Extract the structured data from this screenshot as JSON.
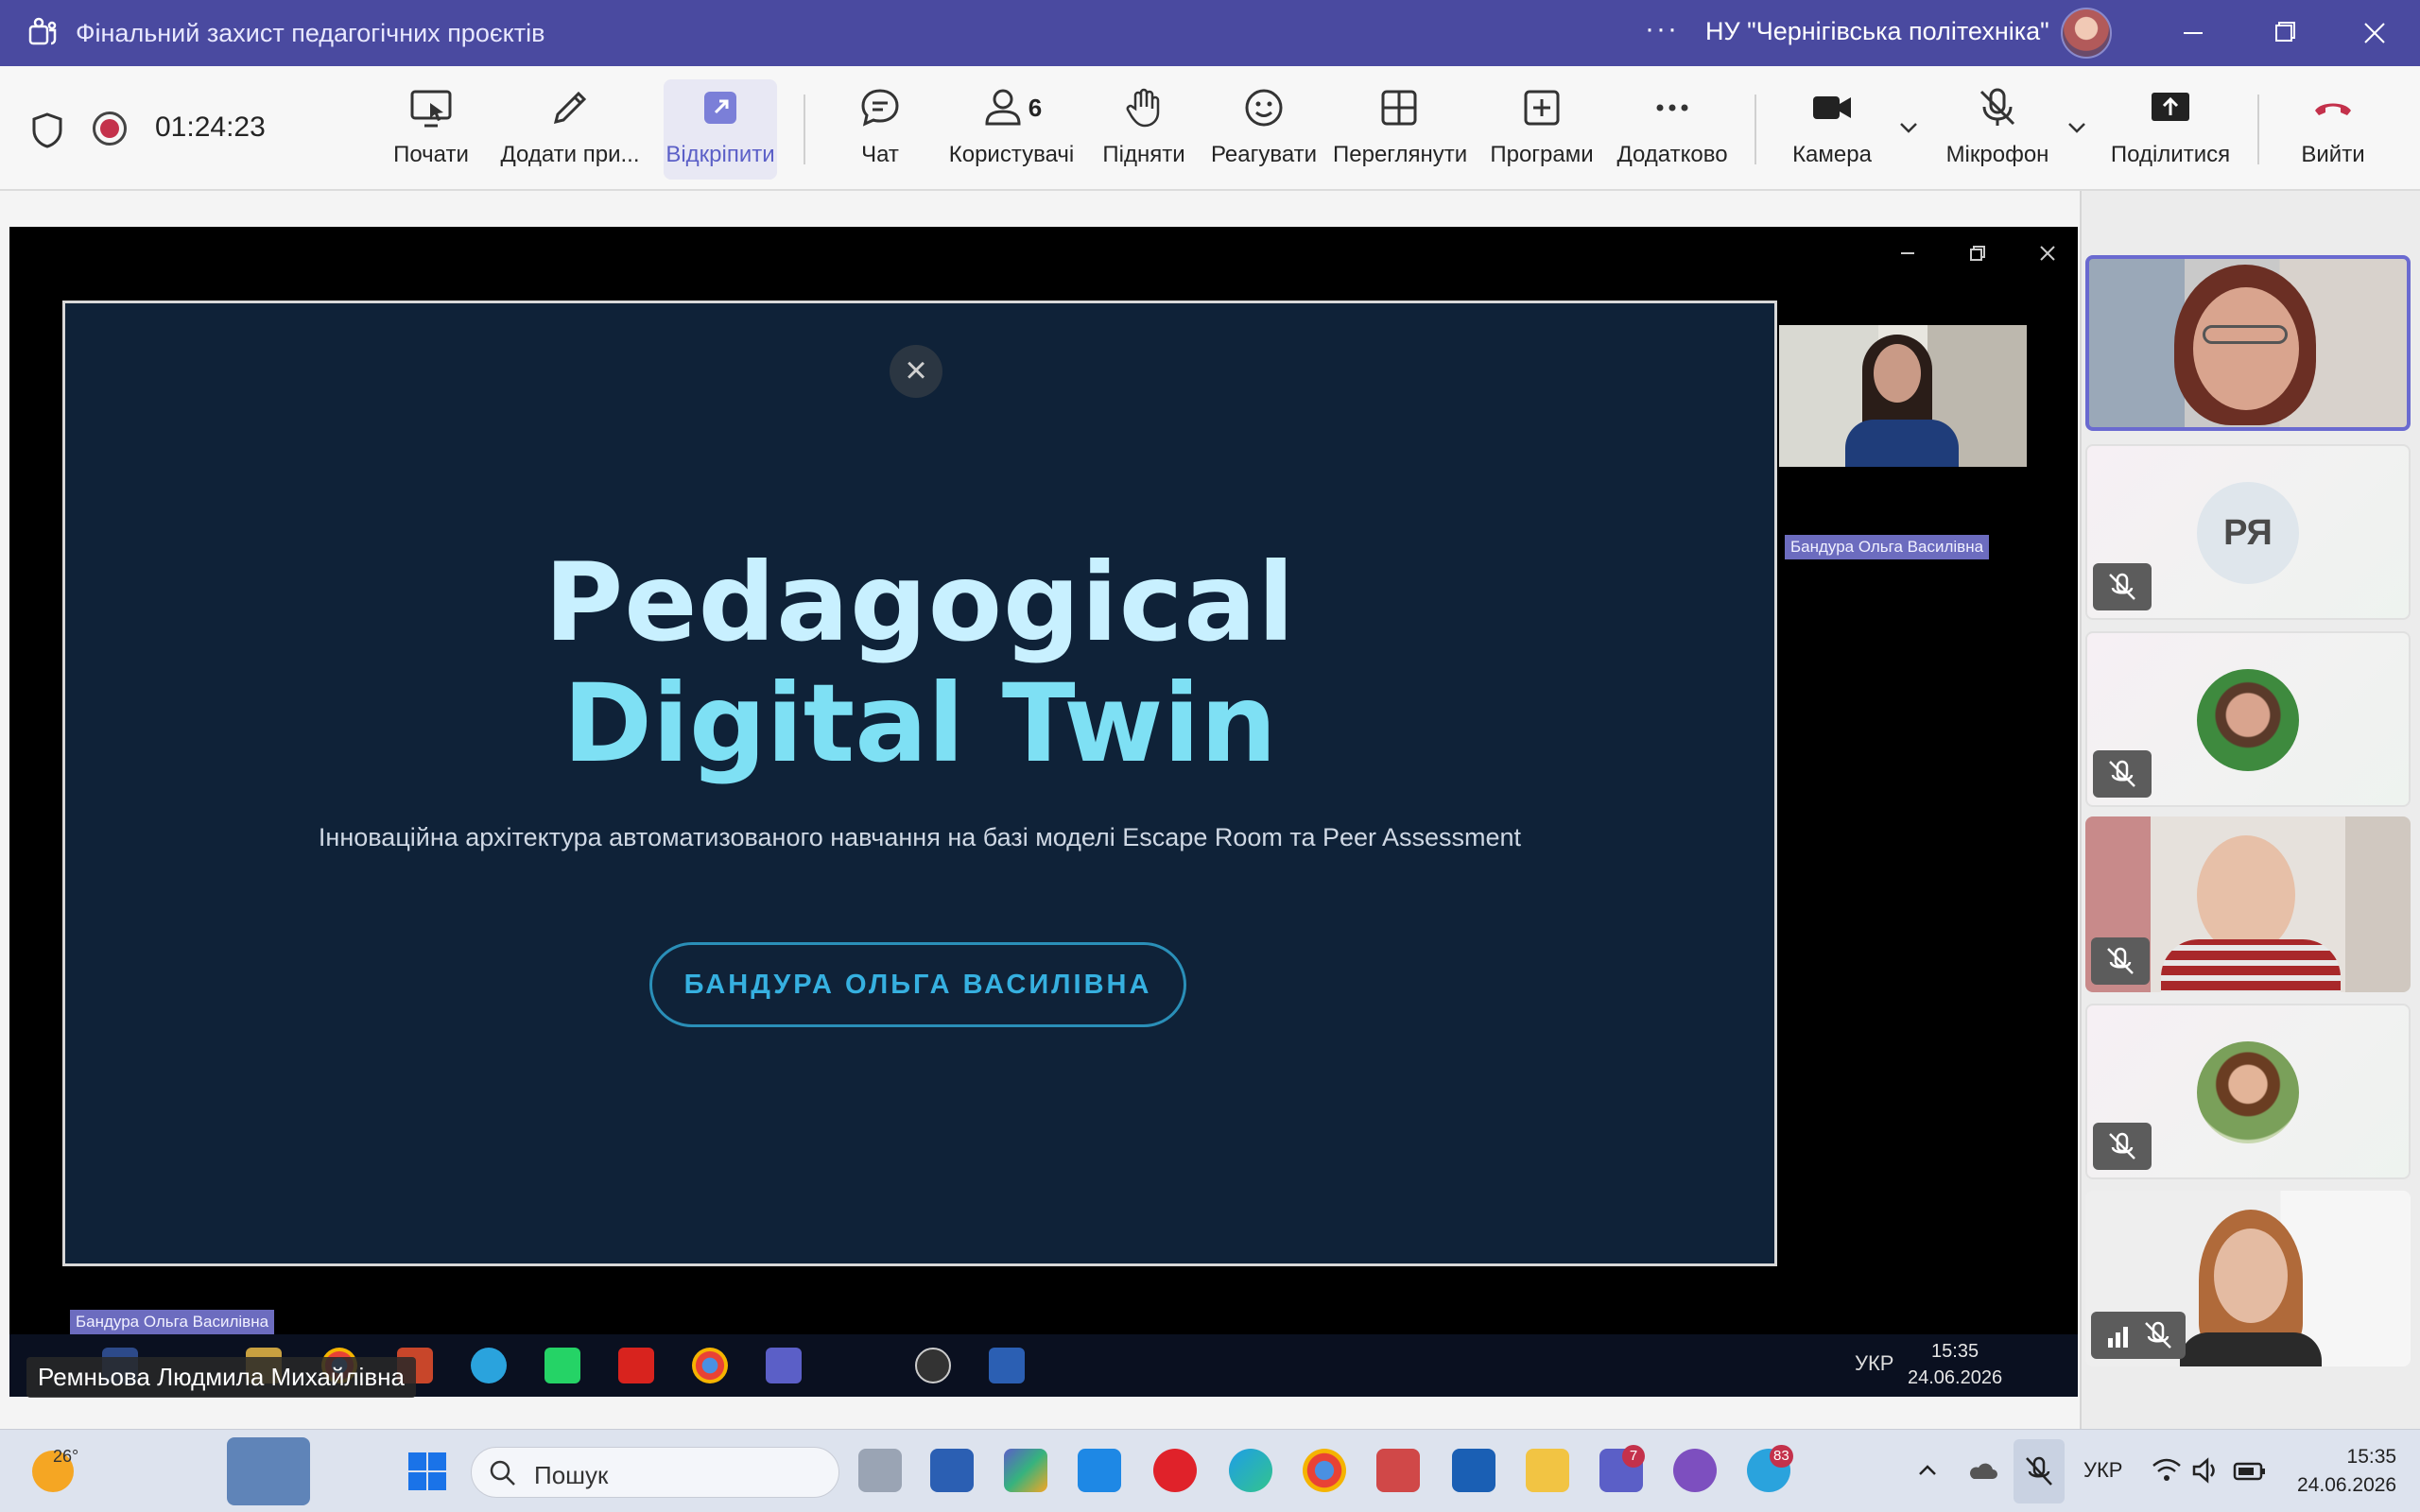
{
  "titlebar": {
    "title": "Фінальний захист педагогічних проєктів",
    "more": "···",
    "org": "НУ \"Чернігівська політехніка\""
  },
  "toolbar": {
    "timer": "01:24:23",
    "buttons": [
      {
        "label": "Почати",
        "icon": "start-share-icon"
      },
      {
        "label": "Додати при...",
        "icon": "pen-icon"
      },
      {
        "label": "Відкріпити",
        "icon": "popout-icon"
      },
      {
        "label": "Чат",
        "icon": "chat-icon"
      },
      {
        "label": "Користувачі",
        "icon": "people-icon",
        "count": "6"
      },
      {
        "label": "Підняти",
        "icon": "raise-hand-icon"
      },
      {
        "label": "Реагувати",
        "icon": "smile-icon"
      },
      {
        "label": "Переглянути",
        "icon": "view-icon"
      },
      {
        "label": "Програми",
        "icon": "apps-icon"
      },
      {
        "label": "Додатково",
        "icon": "more-icon"
      },
      {
        "label": "Камера",
        "icon": "camera-icon"
      },
      {
        "label": "Мікрофон",
        "icon": "mic-off-icon"
      },
      {
        "label": "Поділитися",
        "icon": "share-icon"
      },
      {
        "label": "Вийти",
        "icon": "leave-icon"
      }
    ]
  },
  "slide": {
    "title_line1": "Pedagogical",
    "title_line2": "Digital Twin",
    "subtitle": "Інноваційна архітектура автоматизованого навчання на базі моделі Escape Room та Peer Assessment",
    "presenter_button": "БАНДУРА ОЛЬГА ВАСИЛІВНА",
    "close": "×"
  },
  "shared_screen": {
    "remote_name": "Бандура Ольга Василівна",
    "bottom_name": "Бандура Ольга Василівна",
    "inner_lang": "УКР",
    "inner_time": "15:35",
    "inner_date": "24.06.2026"
  },
  "presenter_label": "Ремньова Людмила Михайлівна",
  "participants": [
    {
      "type": "video",
      "name": "participant-1"
    },
    {
      "type": "initials",
      "initials": "РЯ",
      "muted": true
    },
    {
      "type": "avatar",
      "muted": true
    },
    {
      "type": "video",
      "muted": true
    },
    {
      "type": "avatar",
      "muted": true
    },
    {
      "type": "video",
      "muted": true
    }
  ],
  "taskbar": {
    "temperature": "26°",
    "search_placeholder": "Пошук",
    "teams_badge": "7",
    "telegram_badge": "83",
    "lang": "УКР",
    "time": "15:35",
    "date": "24.06.2026"
  },
  "colors": {
    "titlebar": "#4a4aa0",
    "accent": "#5b5fc7",
    "leave": "#c4314b",
    "slide_bg": "#0f2238",
    "slide_title": "#7ee0f4"
  }
}
